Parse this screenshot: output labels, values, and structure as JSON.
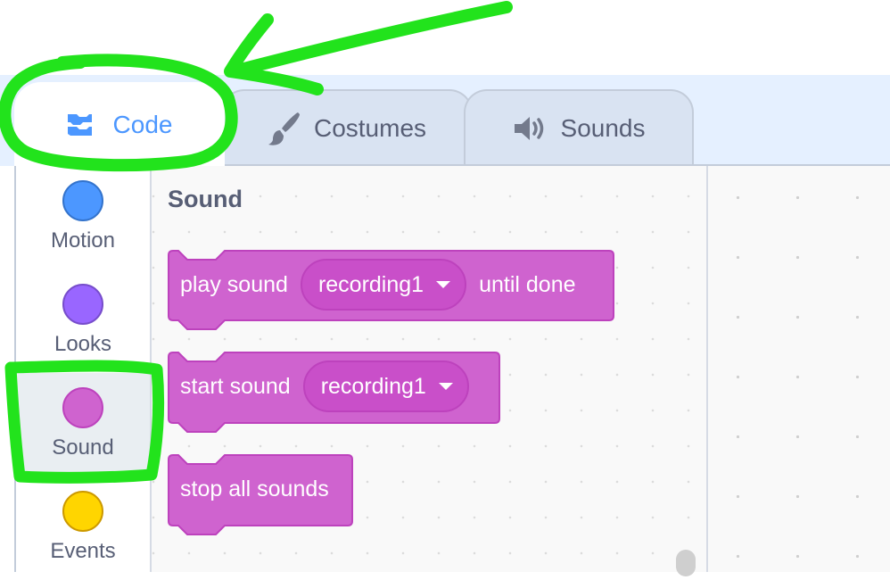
{
  "tabs": [
    {
      "label": "Code",
      "icon": "code-icon",
      "active": true
    },
    {
      "label": "Costumes",
      "icon": "paintbrush-icon",
      "active": false
    },
    {
      "label": "Sounds",
      "icon": "speaker-icon",
      "active": false
    }
  ],
  "categories": [
    {
      "label": "Motion",
      "color": "#4c97ff",
      "border": "#3373cc",
      "selected": false
    },
    {
      "label": "Looks",
      "color": "#9966ff",
      "border": "#774dcb",
      "selected": false
    },
    {
      "label": "Sound",
      "color": "#cf63cf",
      "border": "#bd42bd",
      "selected": true
    },
    {
      "label": "Events",
      "color": "#ffd500",
      "border": "#cc9900",
      "selected": false
    }
  ],
  "palette": {
    "section_title": "Sound",
    "blocks": [
      {
        "pre": "play sound",
        "dropdown": "recording1",
        "post": "until done"
      },
      {
        "pre": "start sound",
        "dropdown": "recording1",
        "post": ""
      },
      {
        "pre": "stop all sounds",
        "dropdown": "",
        "post": ""
      }
    ]
  },
  "annotation_color": "#22e31c",
  "block_color": "#cf63cf",
  "block_border": "#bd42bd"
}
